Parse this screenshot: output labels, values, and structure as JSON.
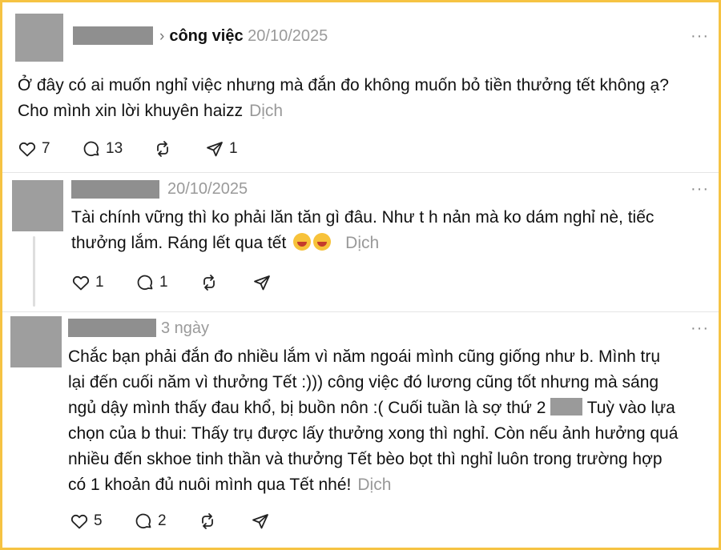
{
  "post1": {
    "topic": "công việc",
    "date": "20/10/2025",
    "more": "···",
    "line1": "Ở đây có ai muốn nghỉ việc nhưng mà đắn đo không muốn bỏ tiền thưởng tết không ạ?",
    "line2": "Cho mình xin lời khuyên haizz",
    "translate": "Dịch",
    "likes": "7",
    "comments": "13",
    "shares": "1"
  },
  "reply1": {
    "date": "20/10/2025",
    "more": "···",
    "line1": "Tài chính vững thì ko phải lăn tăn gì đâu. Như t h nản mà ko dám nghỉ nè, tiếc",
    "line2": "thưởng lắm. Ráng lết qua tết",
    "translate": "Dịch",
    "likes": "1",
    "comments": "1"
  },
  "reply2": {
    "date": "3 ngày",
    "more": "···",
    "line1": "Chắc bạn phải đắn đo nhiều lắm vì năm ngoái mình cũng giống như b. Mình trụ",
    "line2": "lại đến cuối năm vì thưởng Tết :))) công việc đó lương cũng tốt nhưng mà sáng",
    "line3a": "ngủ dậy mình thấy đau khổ, bị buồn nôn :( Cuối tuần là sợ thứ 2",
    "line3b": "Tuỳ vào lựa",
    "line4": "chọn của b thui: Thấy trụ được lấy thưởng xong thì nghỉ. Còn nếu ảnh hưởng quá",
    "line5": "nhiều đến skhoe tinh thần và thưởng Tết bèo bọt thì nghỉ luôn trong trường hợp",
    "line6": "có 1 khoản đủ nuôi mình qua Tết nhé!",
    "translate": "Dịch",
    "likes": "5",
    "comments": "2"
  },
  "icons": {
    "like": "heart-icon",
    "comment": "comment-icon",
    "repost": "repost-icon",
    "share": "send-icon"
  },
  "colors": {
    "border": "#f6c343",
    "redaction": "#9e9e9e",
    "muted": "#999999"
  }
}
